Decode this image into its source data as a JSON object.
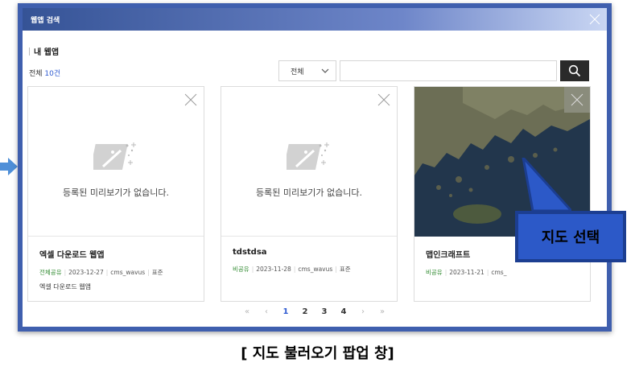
{
  "modal": {
    "title": "웹앱 검색",
    "section_title": "내 웹앱",
    "count_prefix": "전체 ",
    "count_value": "10건",
    "filter": {
      "selected": "전체"
    },
    "search": {
      "placeholder": "",
      "value": ""
    }
  },
  "cards": [
    {
      "title": "엑셀 다운로드 웹앱",
      "preview_text": "등록된 미리보기가 없습니다.",
      "share": "전체공유",
      "date": "2023-12-27",
      "owner": "cms_wavus",
      "template": "표준",
      "description": "엑셀 다운로드 웹앱"
    },
    {
      "title": "tdstdsa",
      "preview_text": "등록된 미리보기가 없습니다.",
      "share": "비공유",
      "date": "2023-11-28",
      "owner": "cms_wavus",
      "template": "표준",
      "description": ""
    },
    {
      "title": "맵인크래프트",
      "preview_text": "",
      "share": "비공유",
      "date": "2023-11-21",
      "owner": "cms_",
      "template": "",
      "description": ""
    }
  ],
  "pagination": {
    "first": "«",
    "prev": "‹",
    "pages": [
      "1",
      "2",
      "3",
      "4"
    ],
    "current": "1",
    "next": "›",
    "last": "»"
  },
  "callout": {
    "text": "지도 선택"
  },
  "caption": "[ 지도 불러오기 팝업 창]",
  "colors": {
    "accent": "#2f5bd1",
    "header": "#3f5fae",
    "share_green": "#2f8a2f",
    "callout": "#2c59c8"
  },
  "icons": [
    "close-icon",
    "search-icon",
    "magic-wand-icon",
    "chevron-down-icon",
    "arrow-right-icon"
  ]
}
